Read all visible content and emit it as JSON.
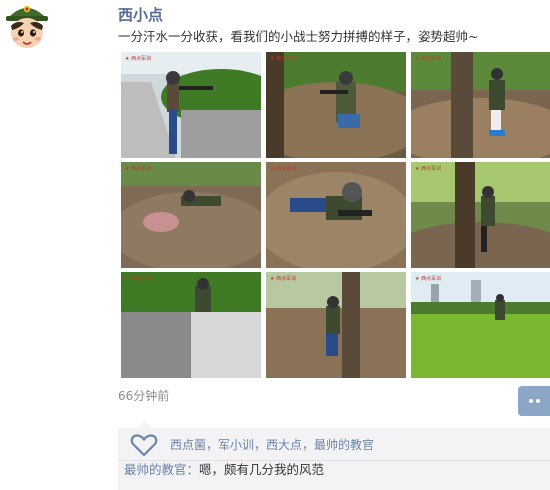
{
  "post": {
    "username": "西小点",
    "text": "一分汗水一分收获，看我们的小战士努力拼搏的样子，姿势超帅~",
    "timestamp": "66分钟前"
  },
  "photos": [
    {
      "scene": "kid-aiming-by-hedge"
    },
    {
      "scene": "kid-crouching-in-woods"
    },
    {
      "scene": "kid-standing-by-tree"
    },
    {
      "scene": "kid-prone-on-leaves"
    },
    {
      "scene": "kid-crawling-closeup"
    },
    {
      "scene": "kid-behind-tree"
    },
    {
      "scene": "kid-behind-stone-wall"
    },
    {
      "scene": "kid-behind-tree-trunk"
    },
    {
      "scene": "kid-on-grass-lawn"
    }
  ],
  "likes": {
    "icon": "heart-icon",
    "names": "西点菌，军小训，西大点，最帅的教官"
  },
  "comment": {
    "author": "最帅的教官：",
    "text": "嗯，颇有几分我的风范"
  },
  "colors": {
    "name_link": "#576b95",
    "panel_bg": "#f3f3f5",
    "more_button": "#8ca6c7"
  }
}
